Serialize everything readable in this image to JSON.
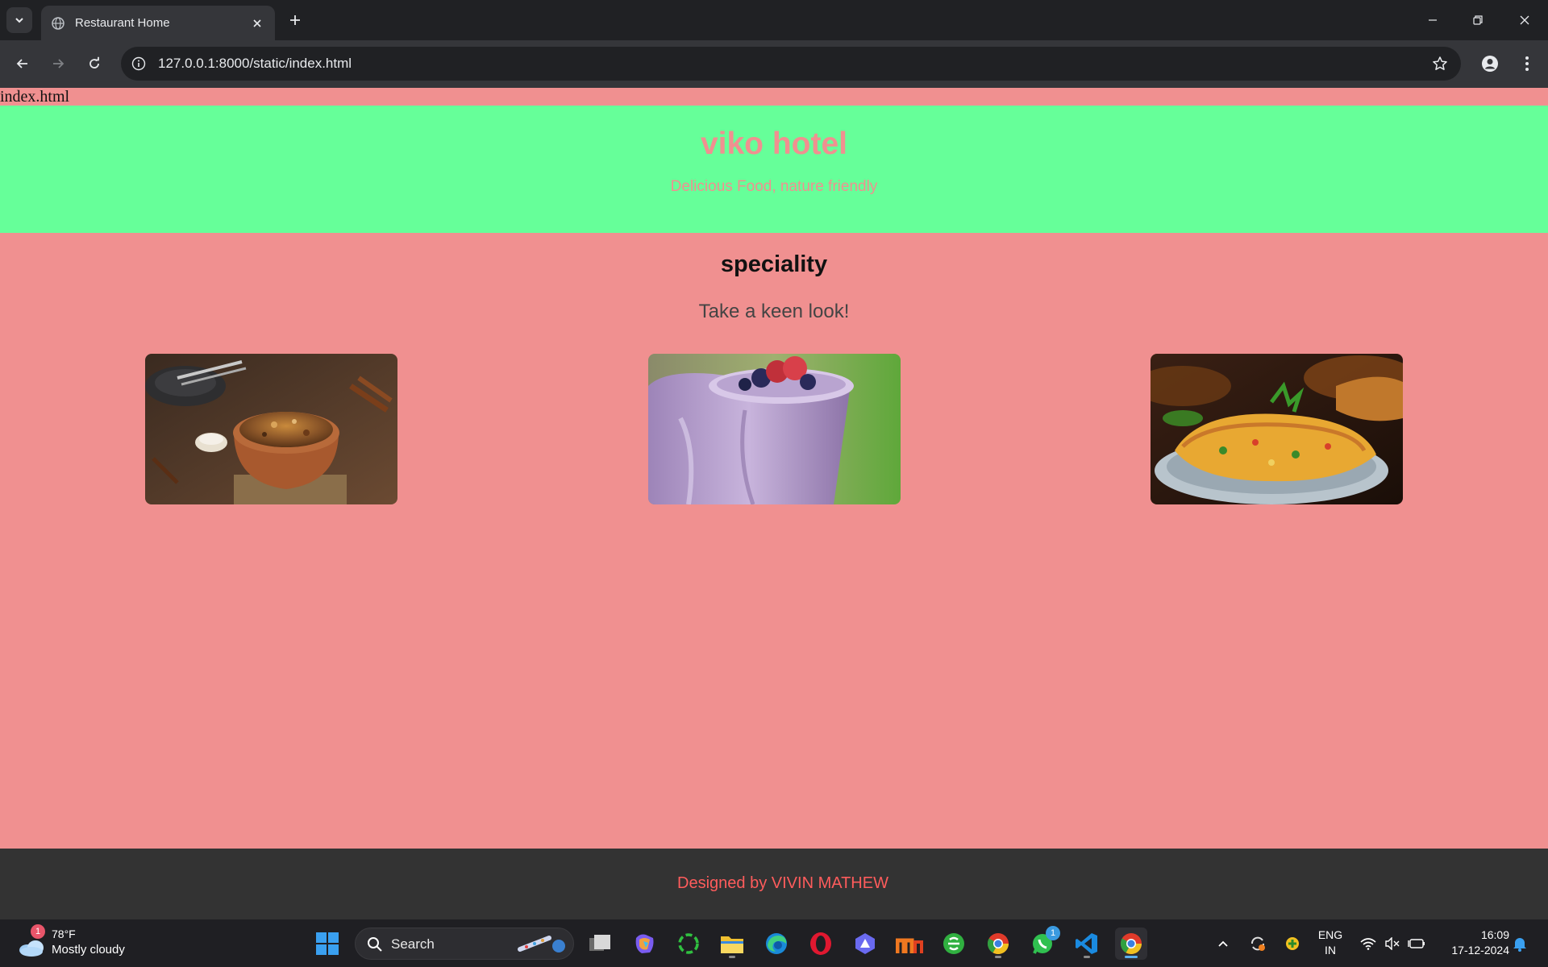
{
  "browser": {
    "tab_title": "Restaurant Home",
    "url": "127.0.0.1:8000/static/index.html"
  },
  "page": {
    "filename_text": "index.html",
    "hero": {
      "title": "viko hotel",
      "tagline": "Delicious Food, nature friendly"
    },
    "section": {
      "title": "speciality",
      "subtitle": "Take a keen look!"
    },
    "gallery": [
      {
        "name": "biryani-image"
      },
      {
        "name": "berry-smoothie-image"
      },
      {
        "name": "omelette-image"
      }
    ],
    "footer_text": "Designed by VIVIN MATHEW",
    "colors": {
      "page_bg": "#f09090",
      "hero_bg": "#66ff99",
      "footer_bg": "#333333",
      "footer_text": "#ff5c5c"
    }
  },
  "taskbar": {
    "weather_badge": "1",
    "weather_temp": "78°F",
    "weather_condition": "Mostly cloudy",
    "search_label": "Search",
    "whatsapp_badge": "1",
    "language_line1": "ENG",
    "language_line2": "IN",
    "time": "16:09",
    "date": "17-12-2024"
  }
}
